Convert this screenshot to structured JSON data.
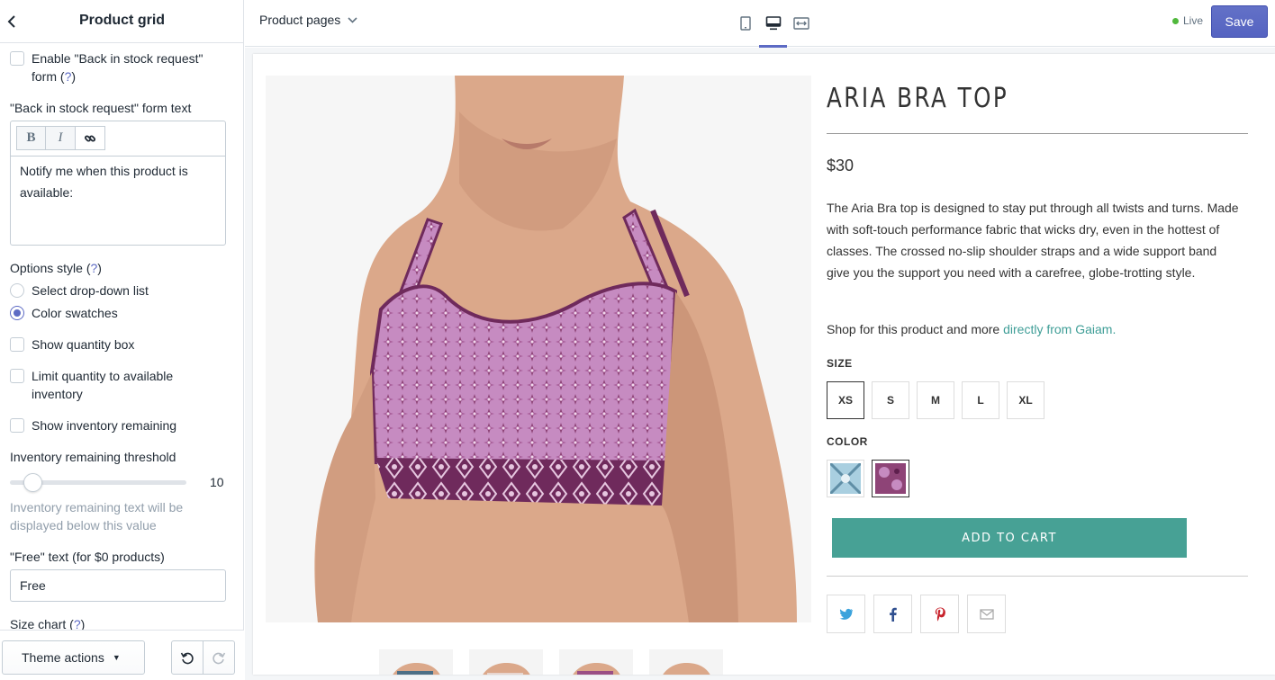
{
  "sidebar": {
    "title": "Product grid",
    "back_icon": "chevron-left-icon",
    "back_in_stock": {
      "label": "Enable \"Back in stock request\"",
      "label2": "form (",
      "help": "?",
      "label3": ")",
      "checked": false
    },
    "form_text": {
      "label": "\"Back in stock request\" form text",
      "toolbar": {
        "bold": "B",
        "italic": "I",
        "link_icon": "link-icon"
      },
      "value": "Notify me when this product is available:"
    },
    "options_style": {
      "label": "Options style (",
      "help": "?",
      "label_end": ")",
      "options": [
        {
          "label": "Select drop-down list",
          "selected": false
        },
        {
          "label": "Color swatches",
          "selected": true
        }
      ]
    },
    "show_quantity_box": {
      "label": "Show quantity box",
      "checked": false
    },
    "limit_quantity": {
      "label": "Limit quantity to available",
      "label2": "inventory",
      "checked": false
    },
    "show_inventory_remaining": {
      "label": "Show inventory remaining",
      "checked": false
    },
    "inventory_threshold": {
      "label": "Inventory remaining threshold",
      "value": "10",
      "hint_line1": "Inventory remaining text will be",
      "hint_line2": "displayed below this value"
    },
    "free_text": {
      "label": "\"Free\" text (for $0 products)",
      "value": "Free"
    },
    "size_chart": {
      "label": "Size chart (",
      "help": "?",
      "label_end": ")"
    },
    "footer": {
      "theme_actions": "Theme actions",
      "theme_actions_icon": "caret-down-icon",
      "undo_icon": "undo-icon",
      "redo_icon": "redo-icon"
    }
  },
  "topbar": {
    "page_select": "Product pages",
    "page_select_icon": "chevron-down-icon",
    "views": [
      "mobile-icon",
      "desktop-icon",
      "fullscreen-icon"
    ],
    "active_view": "desktop-icon",
    "status": "Live",
    "status_color": "#50b83c",
    "save": "Save",
    "accent": "#5c6ac4"
  },
  "product": {
    "title": "ARIA BRA TOP",
    "price": "$30",
    "description": "The Aria Bra top is designed to stay put through all twists and turns. Made with soft-touch performance fabric that wicks dry, even in the hottest of classes. The crossed no-slip shoulder straps and a wide support band give you the support you need with a carefree, globe-trotting style.",
    "shop_text": "Shop for this product and more ",
    "shop_link": "directly from Gaiam.",
    "size_label": "SIZE",
    "sizes": [
      "XS",
      "S",
      "M",
      "L",
      "XL"
    ],
    "selected_size": "XS",
    "color_label": "COLOR",
    "colors": [
      "#a9cfe0",
      "#8e4477"
    ],
    "selected_color": 1,
    "add_to_cart": "ADD TO CART",
    "button_color": "#47a195",
    "share_icons": [
      "twitter-icon",
      "facebook-icon",
      "pinterest-icon",
      "email-icon"
    ]
  }
}
